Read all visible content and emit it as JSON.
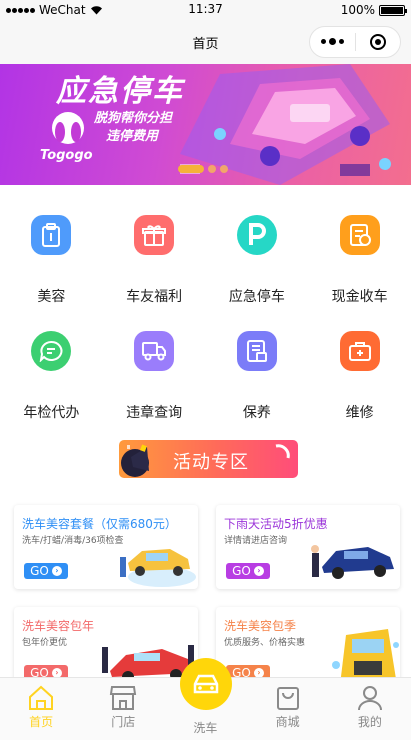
{
  "status_bar": {
    "carrier": "WeChat",
    "time": "11:37",
    "battery": "100%"
  },
  "nav": {
    "title": "首页"
  },
  "banner": {
    "title": "应急停车",
    "slogan_line1": "脱狗帮你分担",
    "slogan_line2": "违停费用",
    "logo_text": "Togogo",
    "slides": 3,
    "active_slide": 1
  },
  "grid": [
    {
      "label": "美容",
      "icon": "clipboard-icon",
      "color": "#4f9bfb"
    },
    {
      "label": "车友福利",
      "icon": "gift-icon",
      "color": "#ff6d6d"
    },
    {
      "label": "应急停车",
      "icon": "parking-icon",
      "color": "#26d7c6"
    },
    {
      "label": "现金收车",
      "icon": "cash-receipt-icon",
      "color": "#ff9f1c"
    },
    {
      "label": "年检代办",
      "icon": "message-icon",
      "color": "#3ccf71"
    },
    {
      "label": "违章查询",
      "icon": "truck-icon",
      "color": "#9a7dfb"
    },
    {
      "label": "保养",
      "icon": "document-icon",
      "color": "#7b7cf8"
    },
    {
      "label": "维修",
      "icon": "toolbox-icon",
      "color": "#ff6b33"
    }
  ],
  "activity": {
    "label": "活动专区"
  },
  "promos": [
    {
      "title": "洗车美容套餐（仅需680元）",
      "subtitle": "洗车/打蜡/消毒/36项检查",
      "go": "GO",
      "title_color": "#2f8ff5",
      "go_color": "#2f8ff5"
    },
    {
      "title": "下雨天活动5折优惠",
      "subtitle": "详情请进店咨询",
      "go": "GO",
      "title_color": "#9b35d9",
      "go_color": "#b83de3"
    },
    {
      "title": "洗车美容包年",
      "subtitle": "包年价更优",
      "go": "GO",
      "title_color": "#f36a6a",
      "go_color": "#f36a6a"
    },
    {
      "title": "洗车美容包季",
      "subtitle": "优质服务、价格实惠",
      "go": "GO",
      "title_color": "#f5834a",
      "go_color": "#f5834a"
    }
  ],
  "tabbar": [
    {
      "label": "首页",
      "icon": "home-icon",
      "active": true
    },
    {
      "label": "门店",
      "icon": "store-icon",
      "active": false
    },
    {
      "label": "洗车",
      "icon": "car-icon",
      "active": false
    },
    {
      "label": "商城",
      "icon": "shopping-bag-icon",
      "active": false
    },
    {
      "label": "我的",
      "icon": "user-icon",
      "active": false
    }
  ]
}
